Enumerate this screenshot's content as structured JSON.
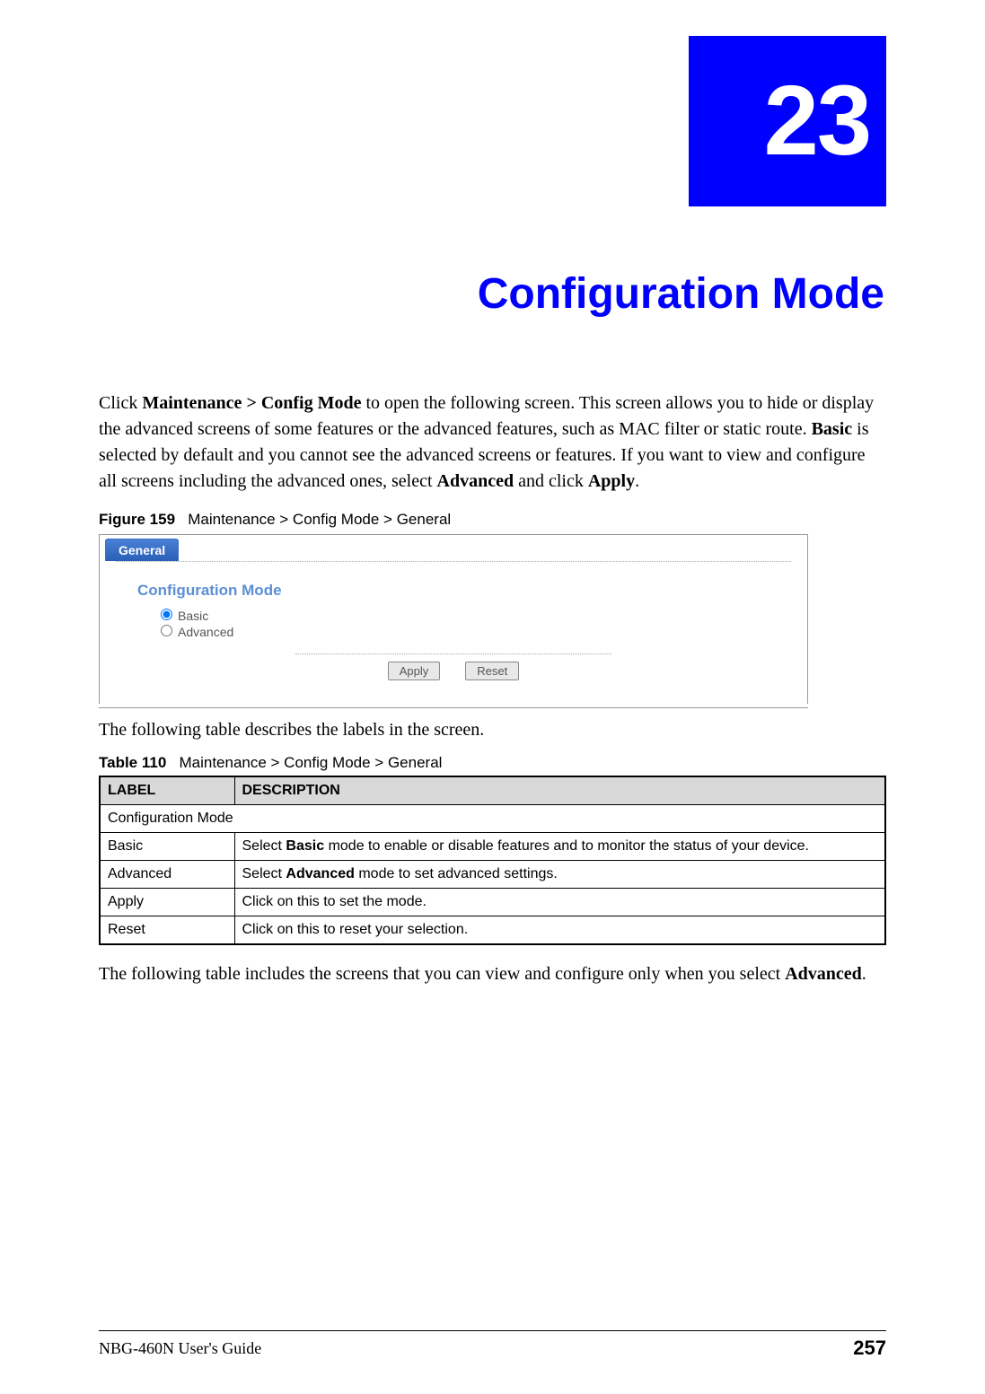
{
  "chapter": {
    "number": "23",
    "title": "Configuration Mode"
  },
  "intro": {
    "p1_a": "Click ",
    "p1_b": "Maintenance > Config Mode",
    "p1_c": " to open the following screen. This screen allows you to hide or display the advanced screens of some features or the advanced features, such as MAC filter or static route. ",
    "p1_d": "Basic",
    "p1_e": " is selected by default and you cannot see the advanced screens or features. If you want to view and configure all screens including the advanced ones, select ",
    "p1_f": "Advanced",
    "p1_g": " and click ",
    "p1_h": "Apply",
    "p1_i": "."
  },
  "figure": {
    "label": "Figure 159",
    "caption": "Maintenance > Config Mode > General",
    "tab": "General",
    "panel_title": "Configuration Mode",
    "option_basic": "Basic",
    "option_advanced": "Advanced",
    "btn_apply": "Apply",
    "btn_reset": "Reset"
  },
  "below_figure": "The following table describes the labels in the screen.",
  "table": {
    "label": "Table 110",
    "caption": "Maintenance > Config Mode > General",
    "headers": {
      "label": "LABEL",
      "description": "DESCRIPTION"
    },
    "rows": [
      {
        "label": "Configuration Mode",
        "description": "",
        "span": true
      },
      {
        "label": "Basic",
        "desc_a": "Select ",
        "desc_b": "Basic",
        "desc_c": " mode to enable or disable features and to monitor the status of your device."
      },
      {
        "label": "Advanced",
        "desc_a": "Select ",
        "desc_b": "Advanced",
        "desc_c": " mode to set advanced settings."
      },
      {
        "label": "Apply",
        "desc_a": "Click on this to set the mode.",
        "desc_b": "",
        "desc_c": ""
      },
      {
        "label": "Reset",
        "desc_a": "Click on this to reset your selection.",
        "desc_b": "",
        "desc_c": ""
      }
    ]
  },
  "after_table": {
    "a": "The following table includes the screens that you can view and configure only when you select ",
    "b": "Advanced",
    "c": "."
  },
  "footer": {
    "guide": "NBG-460N User's Guide",
    "page": "257"
  }
}
